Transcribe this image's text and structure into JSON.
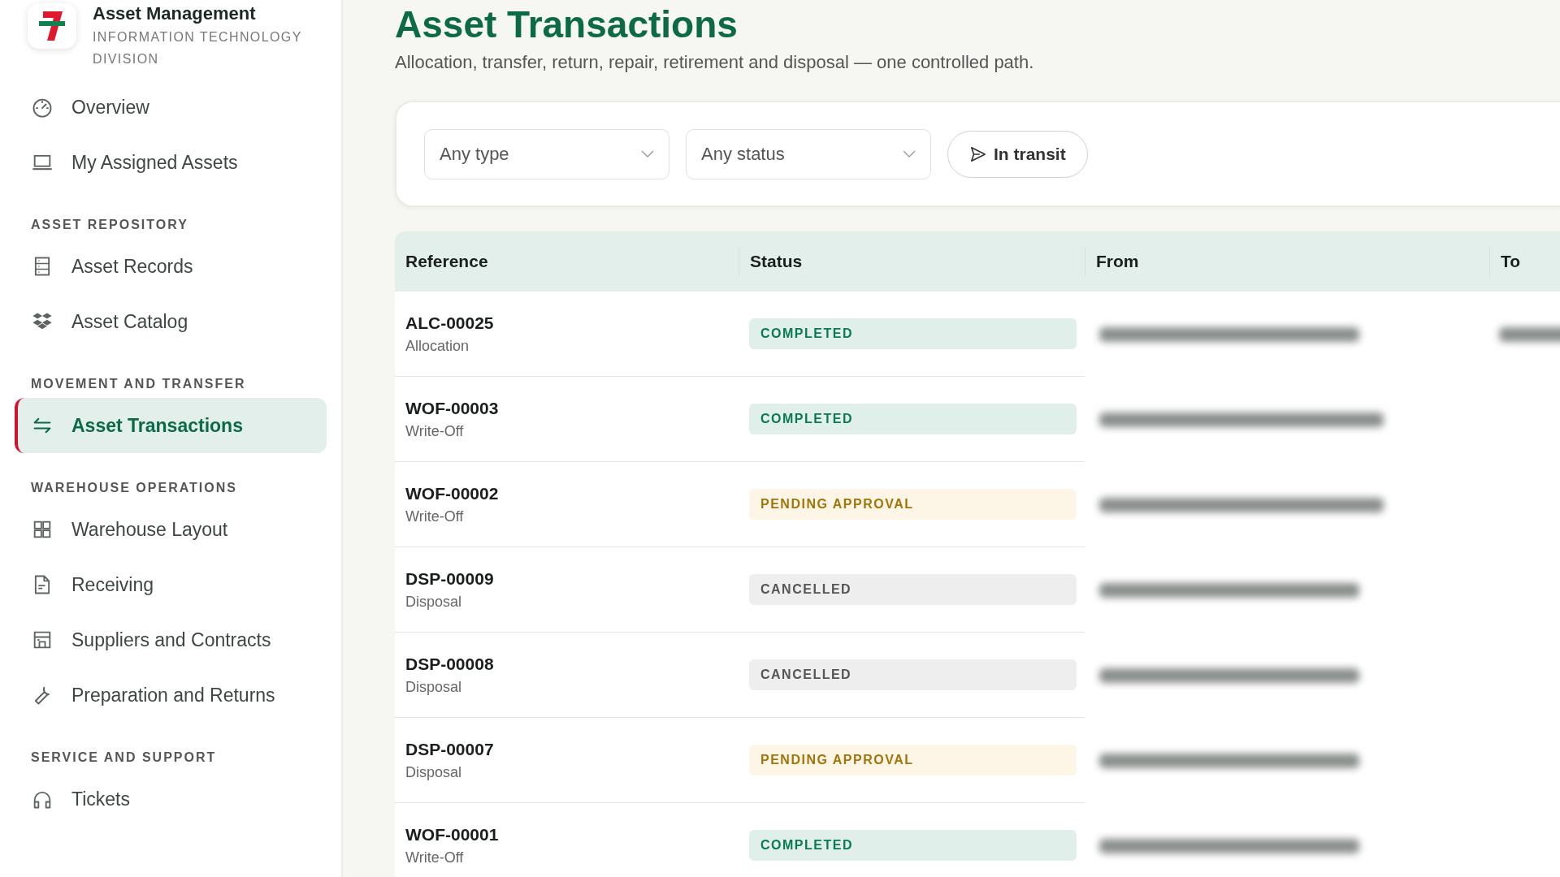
{
  "sidebar": {
    "brand": {
      "title": "Asset Management",
      "subtitle": "INFORMATION TECHNOLOGY DIVISION"
    },
    "sections": [
      {
        "items": [
          {
            "label": "Overview",
            "selected": false
          },
          {
            "label": "My Assigned Assets",
            "selected": false
          }
        ]
      },
      {
        "heading": "ASSET REPOSITORY",
        "items": [
          {
            "label": "Asset Records",
            "selected": false
          },
          {
            "label": "Asset Catalog",
            "selected": false
          }
        ]
      },
      {
        "heading": "MOVEMENT AND TRANSFER",
        "items": [
          {
            "label": "Asset Transactions",
            "selected": true
          }
        ]
      },
      {
        "heading": "WAREHOUSE OPERATIONS",
        "items": [
          {
            "label": "Warehouse Layout",
            "selected": false
          },
          {
            "label": "Receiving",
            "selected": false
          },
          {
            "label": "Suppliers and Contracts",
            "selected": false
          },
          {
            "label": "Preparation and Returns",
            "selected": false
          }
        ]
      },
      {
        "heading": "SERVICE AND SUPPORT",
        "items": [
          {
            "label": "Tickets",
            "selected": false
          }
        ]
      }
    ]
  },
  "page": {
    "title": "Asset Transactions",
    "subtitle": "Allocation, transfer, return, repair, retirement and disposal — one controlled path."
  },
  "filters": {
    "type_select": "Any type",
    "status_select": "Any status",
    "transit_button": "In transit"
  },
  "table": {
    "columns": [
      "Reference",
      "Status",
      "From",
      "To"
    ],
    "rows": [
      {
        "reference": "ALC-00025",
        "type": "Allocation",
        "status": {
          "label": "COMPLETED",
          "kind": "completed"
        }
      },
      {
        "reference": "WOF-00003",
        "type": "Write-Off",
        "status": {
          "label": "COMPLETED",
          "kind": "completed"
        }
      },
      {
        "reference": "WOF-00002",
        "type": "Write-Off",
        "status": {
          "label": "PENDING APPROVAL",
          "kind": "pending"
        }
      },
      {
        "reference": "DSP-00009",
        "type": "Disposal",
        "status": {
          "label": "CANCELLED",
          "kind": "cancelled"
        }
      },
      {
        "reference": "DSP-00008",
        "type": "Disposal",
        "status": {
          "label": "CANCELLED",
          "kind": "cancelled"
        }
      },
      {
        "reference": "DSP-00007",
        "type": "Disposal",
        "status": {
          "label": "PENDING APPROVAL",
          "kind": "pending"
        }
      },
      {
        "reference": "WOF-00001",
        "type": "Write-Off",
        "status": {
          "label": "COMPLETED",
          "kind": "completed"
        }
      }
    ]
  }
}
